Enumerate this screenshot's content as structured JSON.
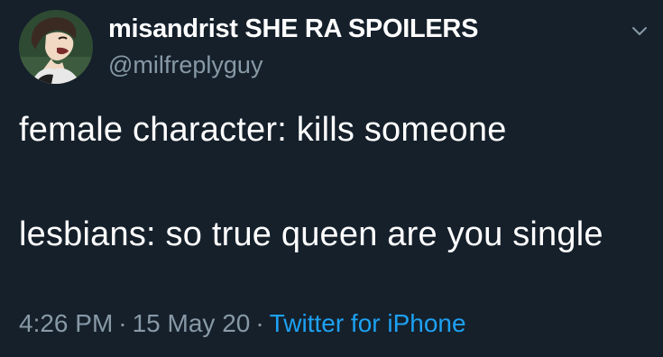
{
  "tweet": {
    "author": {
      "display_name": "misandrist SHE RA SPOILERS",
      "handle": "@milfreplyguy",
      "avatar_icon": "avatar-illustration"
    },
    "text": "female character: kills someone\n\nlesbians: so true queen are you single",
    "meta": {
      "time": "4:26 PM",
      "separator": "·",
      "date": "15 May 20",
      "source": "Twitter for iPhone"
    },
    "menu_icon": "chevron-down-icon"
  },
  "colors": {
    "background": "#15202b",
    "primary_text": "#ffffff",
    "secondary_text": "#8899a6",
    "link": "#1da1f2"
  }
}
